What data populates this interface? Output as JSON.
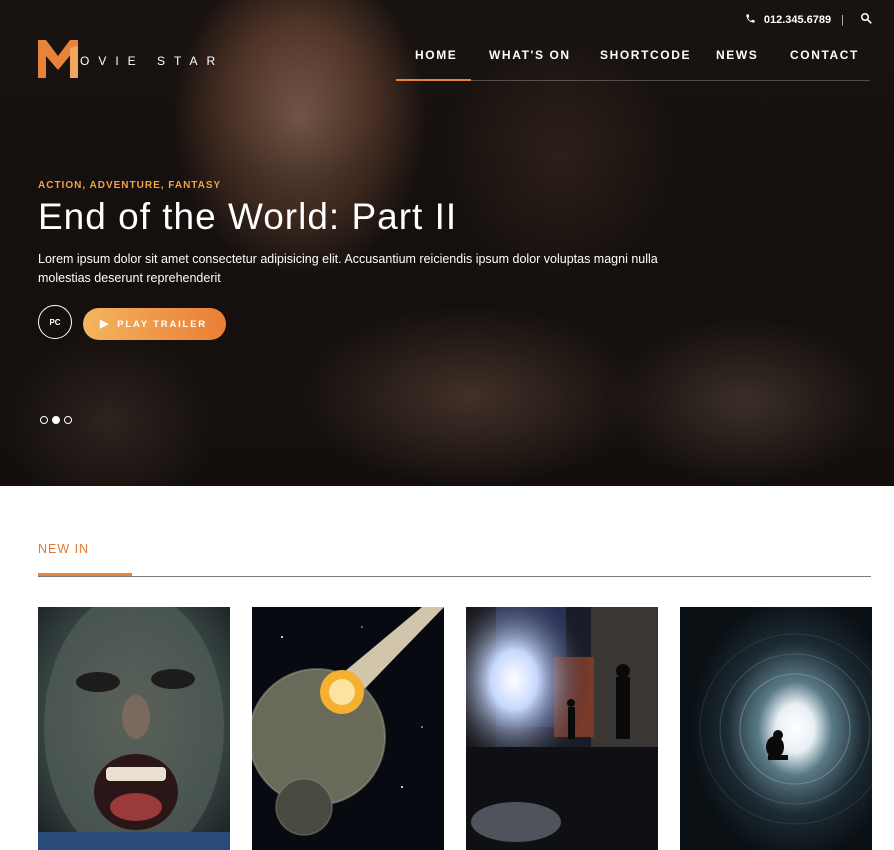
{
  "header": {
    "phone": "012.345.6789",
    "phone_separator": "|",
    "logo_letter": "M",
    "logo_text": "OVIE STAR"
  },
  "nav": {
    "items": [
      {
        "label": "HOME",
        "active": true
      },
      {
        "label": "WHAT'S ON",
        "active": false
      },
      {
        "label": "SHORTCODE",
        "active": false
      },
      {
        "label": "NEWS",
        "active": false
      },
      {
        "label": "CONTACT",
        "active": false
      }
    ]
  },
  "hero": {
    "genres": "ACTION, ADVENTURE, FANTASY",
    "title": "End of the World: Part II",
    "description": "Lorem ipsum dolor sit amet consectetur adipisicing elit. Accusantium reiciendis ipsum dolor voluptas magni nulla molestias deserunt reprehenderit",
    "platform_badge": "PC",
    "play_button_label": "PLAY TRAILER",
    "slides_count": 3,
    "active_slide": 2
  },
  "new_in": {
    "title": "NEW IN",
    "cards": [
      {
        "image": "screaming-face"
      },
      {
        "image": "planet-impact"
      },
      {
        "image": "city-alley-night"
      },
      {
        "image": "tunnel-light"
      }
    ]
  },
  "colors": {
    "accent": "#e8833a",
    "genre_text": "#f0a446",
    "button_gradient_start": "#f4b45e",
    "button_gradient_end": "#ea7e35",
    "section_title": "#e07a35"
  },
  "icons": {
    "phone": "phone-icon",
    "search": "search-icon",
    "play": "play-icon"
  }
}
